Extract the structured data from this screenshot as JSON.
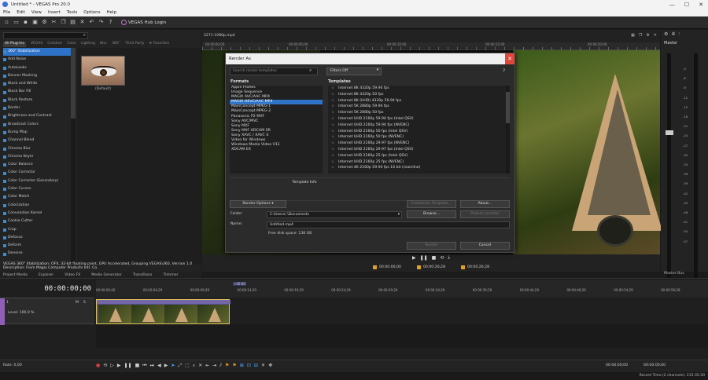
{
  "window": {
    "title": "Untitled * - VEGAS Pro 20.0",
    "min": "—",
    "max": "☐",
    "close": "✕"
  },
  "menu": [
    "File",
    "Edit",
    "View",
    "Insert",
    "Tools",
    "Options",
    "Help"
  ],
  "toolbar": {
    "hub_login": "VEGAS Hub Login"
  },
  "fx": {
    "tabs": [
      "All Plug-Ins",
      "VEGAS",
      "Creative",
      "Color",
      "Lighting",
      "Blur",
      "360°",
      "Third Party",
      "★ Favorites"
    ],
    "items": [
      "360° Stabilization",
      "Add Noise",
      "AutoLooks",
      "Banner Masking",
      "Black and White",
      "Black Bar Fill",
      "Black Restore",
      "Border",
      "Brightness and Contrast",
      "Broadcast Colors",
      "Bump Map",
      "Channel Blend",
      "Chroma Blur",
      "Chroma Keyer",
      "Color Balance",
      "Color Corrector",
      "Color Corrector (Secondary)",
      "Color Curves",
      "Color Match",
      "Colorization",
      "Convolution Kernel",
      "Cookie Cutter",
      "Crop",
      "Defocus",
      "Deform",
      "Denoise"
    ],
    "preset_label": "(Default)",
    "desc_line1": "VEGAS 360° Stabilization: OFX, 32-bit floating point, GPU Accelerated, Grouping VEGAS\\360, Version 1.0",
    "desc_line2": "Description: From Magix Computer Products Intl. Co."
  },
  "panel_tabs": [
    "Project Media",
    "Explorer",
    "Video FX",
    "Media Generator",
    "Transitions",
    "Trimmer"
  ],
  "preview": {
    "file": "2271-1080p.mp4",
    "ruler": [
      "00:00:00;00",
      "00:00:05;00",
      "00:00:10;00",
      "00:00:15;00",
      "00:00:20;00"
    ],
    "tc_start": "00:00:00;00",
    "tc_end": "00:00:26;28",
    "tc_len": "00:00:26;28"
  },
  "master": {
    "title": "Master",
    "tab": "Master Bus",
    "db": [
      "-3",
      "-6",
      "-9",
      "-12",
      "-15",
      "-18",
      "-21",
      "-24",
      "-27",
      "-30",
      "-33",
      "-36",
      "-39",
      "-42",
      "-45",
      "-48",
      "-51",
      "-54",
      "-57"
    ]
  },
  "timeline": {
    "clock": "00:00:00;00",
    "marker": "+00:00",
    "ruler": [
      "00:00:00;00",
      "00:00:04;29",
      "00:00:09;29",
      "00:00:14;29",
      "00:00:19;29",
      "00:00:24;29",
      "00:00:29;29",
      "00:00:34;29",
      "00:00:39;29",
      "00:00:44;29",
      "00:00:49;29",
      "00:00:54;29",
      "00:00:59;28"
    ],
    "track": {
      "num": "1",
      "level": "Level: 100,0 %",
      "m": "M",
      "s": "S"
    }
  },
  "bottom": {
    "rate": "Rate: 0,00",
    "tc1": "00:00:00;00",
    "tc2": "00:00:00;00"
  },
  "status": "Record Time (2 channels): 215:35:30",
  "dialog": {
    "title": "Render As",
    "search_placeholder": "Search render templates",
    "filter": "Filters Off",
    "help": "?",
    "formats_head": "Formats",
    "templates_head": "Templates",
    "formats": [
      "Apple ProRes",
      "Image Sequence",
      "MAGIX AVC/AAC MP4",
      "MAGIX HEVC/AAC MP4",
      "MainConcept MPEG-1",
      "MainConcept MPEG-2",
      "Panasonic P2 MXF",
      "Sony AVC/MVC",
      "Sony MXF",
      "Sony MXF HDCAM SR",
      "Sony XAVC / XAVC S",
      "Video for Windows",
      "Windows Media Video V11",
      "XDCAM EX"
    ],
    "selected_format": 3,
    "templates": [
      "Internet 8K 4320p 59.94 fps",
      "Internet 8K 4320p 50 fps",
      "Internet 8K (UHD) 4320p 59.94 fps",
      "Internet 5K 2880p 59.94 fps",
      "Internet 5K 2880p 50 fps",
      "Internet UHD 2160p 59.94 fps (Intel QSV)",
      "Internet UHD 2160p 59.94 fps (NVENC)",
      "Internet UHD 2160p 50 fps (Intel QSV)",
      "Internet UHD 2160p 50 fps (NVENC)",
      "Internet UHD 2160p 29.97 fps (NVENC)",
      "Internet UHD 2160p 29.97 fps (Intel QSV)",
      "Internet UHD 2160p 25 fps (Intel QSV)",
      "Internet UHD 2160p 25 fps (NVENC)",
      "Internet 4K 2160p 59.94 fps 16 bit (mainline)"
    ],
    "template_info": "Template Info",
    "render_options": "Render Options",
    "customize": "Customize Template...",
    "about": "About...",
    "folder_label": "Folder:",
    "folder_value": "C:\\Users\\       \\Documents",
    "browse": "Browse...",
    "project_location": "Project Location",
    "name_label": "Name:",
    "name_value": "Untitled.mp4",
    "free_space": "Free disk space: 138 GB",
    "render": "Render",
    "cancel": "Cancel"
  }
}
